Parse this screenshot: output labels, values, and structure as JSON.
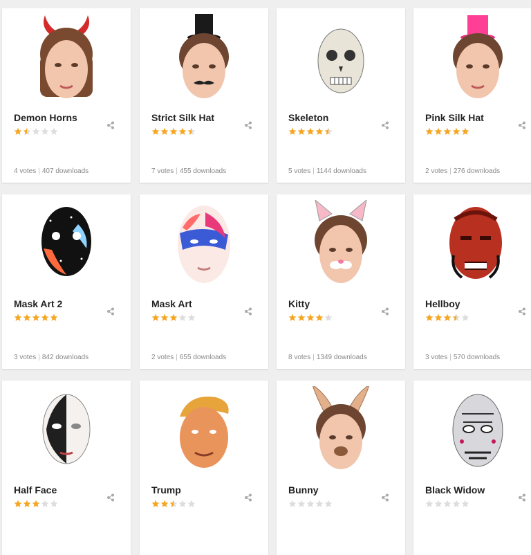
{
  "accent_star": "#f5a623",
  "empty_star": "#dddddd",
  "masks": [
    {
      "name": "Demon Horns",
      "rating": 1.5,
      "votes": "4 votes",
      "downloads": "407 downloads",
      "mask_icon": "demon-horns-mask-icon"
    },
    {
      "name": "Strict Silk Hat",
      "rating": 4.5,
      "votes": "7 votes",
      "downloads": "455 downloads",
      "mask_icon": "silk-hat-mustache-mask-icon"
    },
    {
      "name": "Skeleton",
      "rating": 4.5,
      "votes": "5 votes",
      "downloads": "1144 downloads",
      "mask_icon": "skeleton-mask-icon"
    },
    {
      "name": "Pink Silk Hat",
      "rating": 5,
      "votes": "2 votes",
      "downloads": "276 downloads",
      "mask_icon": "pink-silk-hat-mask-icon"
    },
    {
      "name": "Mask Art 2",
      "rating": 5,
      "votes": "3 votes",
      "downloads": "842 downloads",
      "mask_icon": "mask-art-2-icon"
    },
    {
      "name": "Mask Art",
      "rating": 3,
      "votes": "2 votes",
      "downloads": "655 downloads",
      "mask_icon": "mask-art-icon"
    },
    {
      "name": "Kitty",
      "rating": 4,
      "votes": "8 votes",
      "downloads": "1349 downloads",
      "mask_icon": "kitty-mask-icon"
    },
    {
      "name": "Hellboy",
      "rating": 3.5,
      "votes": "3 votes",
      "downloads": "570 downloads",
      "mask_icon": "hellboy-mask-icon"
    },
    {
      "name": "Half Face",
      "rating": 3,
      "votes": "",
      "downloads": "",
      "mask_icon": "half-face-mask-icon"
    },
    {
      "name": "Trump",
      "rating": 2.5,
      "votes": "",
      "downloads": "",
      "mask_icon": "trump-mask-icon"
    },
    {
      "name": "Bunny",
      "rating": 0,
      "votes": "",
      "downloads": "",
      "mask_icon": "bunny-mask-icon"
    },
    {
      "name": "Black Widow",
      "rating": 0,
      "votes": "",
      "downloads": "",
      "mask_icon": "black-widow-mask-icon"
    }
  ]
}
